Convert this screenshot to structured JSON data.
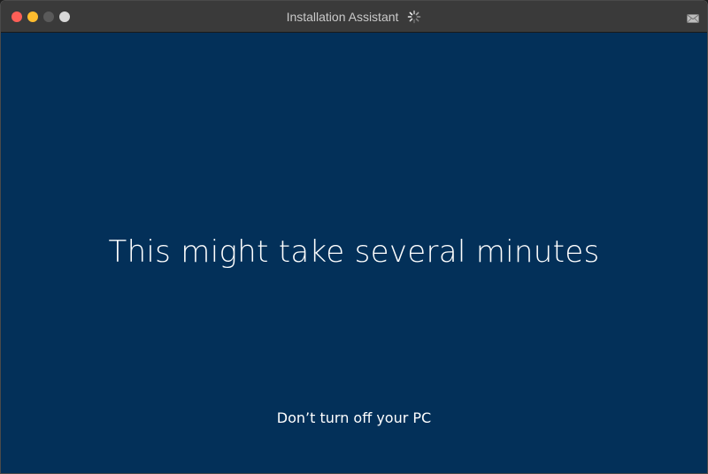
{
  "window": {
    "title": "Installation Assistant",
    "traffic_lights": [
      {
        "name": "close",
        "color": "#fe5f57"
      },
      {
        "name": "minimize",
        "color": "#febc2e"
      },
      {
        "name": "zoom",
        "color": "#5a5a5a"
      },
      {
        "name": "extra",
        "color": "#d9d9d9"
      }
    ],
    "icons": {
      "title_status": "spinner-icon",
      "right": "mail-icon"
    }
  },
  "screen": {
    "headline": "This might take several minutes",
    "subline": "Don’t turn off your PC"
  },
  "colors": {
    "background": "#033059",
    "text": "#ffffff",
    "titlebar": "#3a3a3a",
    "title_text": "#c9c9c9"
  }
}
